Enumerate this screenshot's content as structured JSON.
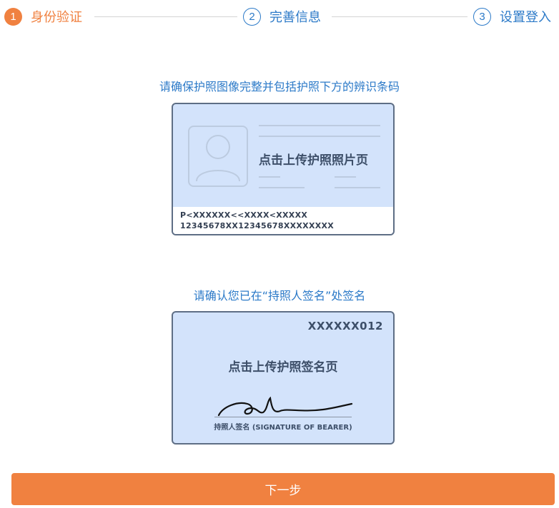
{
  "stepper": {
    "steps": [
      {
        "number": "1",
        "label": "身份验证",
        "state": "active"
      },
      {
        "number": "2",
        "label": "完善信息",
        "state": "inactive"
      },
      {
        "number": "3",
        "label": "设置登入",
        "state": "inactive"
      }
    ]
  },
  "passport_section": {
    "instruction": "请确保护照图像完整并包括护照下方的辨识条码",
    "card_title": "点击上传护照照片页",
    "mrz_line_1": "P<XXXXXX<<XXXX<XXXXX",
    "mrz_line_2": "12345678XX12345678XXXXXXXX"
  },
  "signature_section": {
    "instruction": "请确认您已在“持照人签名”处签名",
    "code": "XXXXXX012",
    "card_title": "点击上传护照签名页",
    "caption": "持照人签名 (SIGNATURE OF BEARER)"
  },
  "next_button": {
    "label": "下一步"
  },
  "colors": {
    "accent": "#f08140",
    "primary": "#2c7ac8",
    "card_bg": "#d3e3fb",
    "card_border": "#5e6e85"
  }
}
